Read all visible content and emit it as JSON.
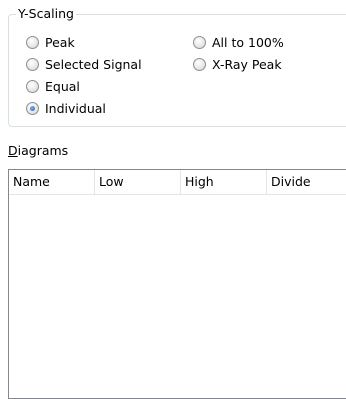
{
  "y_scaling": {
    "legend": "Y-Scaling",
    "options": [
      {
        "label": "Peak",
        "checked": false
      },
      {
        "label": "Selected Signal",
        "checked": false
      },
      {
        "label": "Equal",
        "checked": false
      },
      {
        "label": "Individual",
        "checked": true
      },
      {
        "label": "All to 100%",
        "checked": false
      },
      {
        "label": "X-Ray Peak",
        "checked": false
      }
    ]
  },
  "diagrams": {
    "label_accel": "D",
    "label_rest": "iagrams",
    "columns": [
      "Name",
      "Low",
      "High",
      "Divide"
    ],
    "rows": []
  }
}
